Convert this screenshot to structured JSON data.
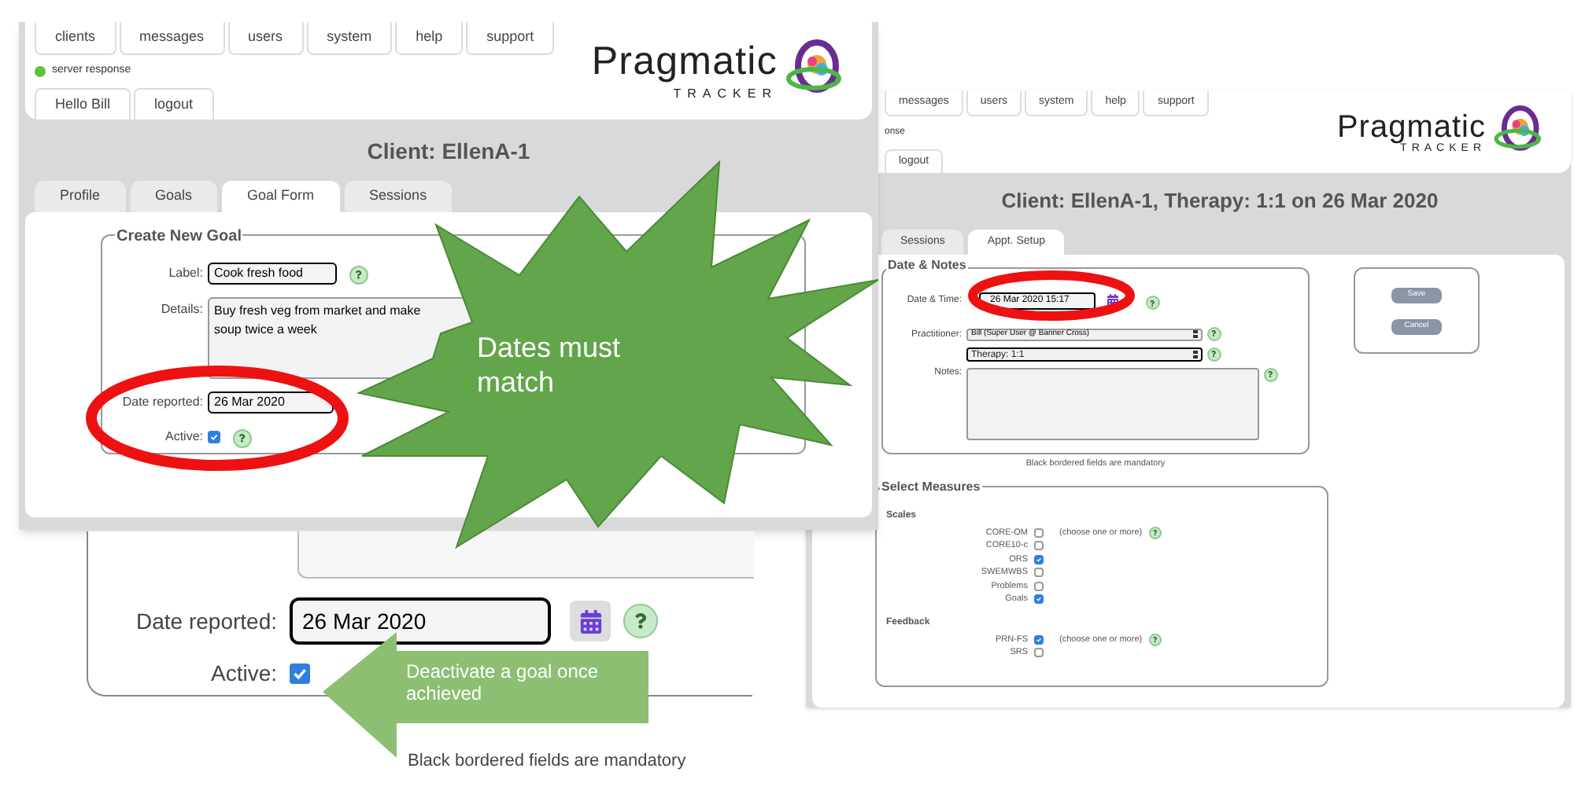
{
  "goal_form_screen": {
    "nav": [
      "clients",
      "messages",
      "users",
      "system",
      "help",
      "support"
    ],
    "status": "server response",
    "user_tabs": [
      "Hello Bill",
      "logout"
    ],
    "logo": {
      "name": "Pragmatic",
      "tagline": "TRACKER"
    },
    "title": "Client: EllenA-1",
    "tabs": [
      {
        "label": "Profile",
        "selected": false
      },
      {
        "label": "Goals",
        "selected": false
      },
      {
        "label": "Goal Form",
        "selected": true
      },
      {
        "label": "Sessions",
        "selected": false
      }
    ],
    "form": {
      "legend": "Create New Goal",
      "label_label": "Label:",
      "label_value": "Cook fresh food",
      "details_label": "Details:",
      "details_lines": [
        "Buy fresh veg from market and make",
        "soup twice a week"
      ],
      "date_label": "Date reported:",
      "date_value": "26 Mar 2020",
      "active_label": "Active:",
      "active_checked": true
    }
  },
  "appointment_screen": {
    "nav": [
      "messages",
      "users",
      "system",
      "help",
      "support"
    ],
    "status": "onse",
    "user_tabs": [
      "logout"
    ],
    "logo": {
      "name": "Pragmatic",
      "tagline": "TRACKER"
    },
    "title": "Client: EllenA-1, Therapy: 1:1 on 26 Mar 2020",
    "tabs": [
      {
        "label": "Sessions",
        "selected": false
      },
      {
        "label": "Appt. Setup",
        "selected": true
      }
    ],
    "legend": "Date & Notes",
    "date_label": "Date & Time:",
    "date_value": "26 Mar 2020 15:17",
    "practitioner_label": "Practitioner:",
    "practitioner_value": "Bill (Super User @ Banner Cross)",
    "type_value": "Therapy: 1:1",
    "notes_label": "Notes:",
    "mandatory_note": "Black bordered fields are mandatory",
    "buttons": [
      "Save",
      "Cancel"
    ],
    "measures_legend": "Select Measures",
    "groups": [
      {
        "title": "Scales",
        "hint": "(choose one or more)",
        "items": [
          {
            "label": "CORE-OM",
            "checked": false
          },
          {
            "label": "CORE10-c",
            "checked": false
          },
          {
            "label": "ORS",
            "checked": true
          },
          {
            "label": "SWEMWBS",
            "checked": false
          },
          {
            "label": "Problems",
            "checked": false
          },
          {
            "label": "Goals",
            "checked": true
          }
        ]
      },
      {
        "title": "Feedback",
        "hint": "(choose one or more)",
        "items": [
          {
            "label": "PRN-FS",
            "checked": true
          },
          {
            "label": "SRS",
            "checked": false
          }
        ]
      }
    ]
  },
  "zoomed_detail": {
    "date_label": "Date reported:",
    "date_value": "26 Mar 2020",
    "active_label": "Active:",
    "active_checked": true,
    "mandatory_note": "Black bordered fields are mandatory"
  },
  "callouts": {
    "starburst": "Dates must match",
    "arrow_lines": [
      "Deactivate a goal once",
      "achieved"
    ]
  }
}
